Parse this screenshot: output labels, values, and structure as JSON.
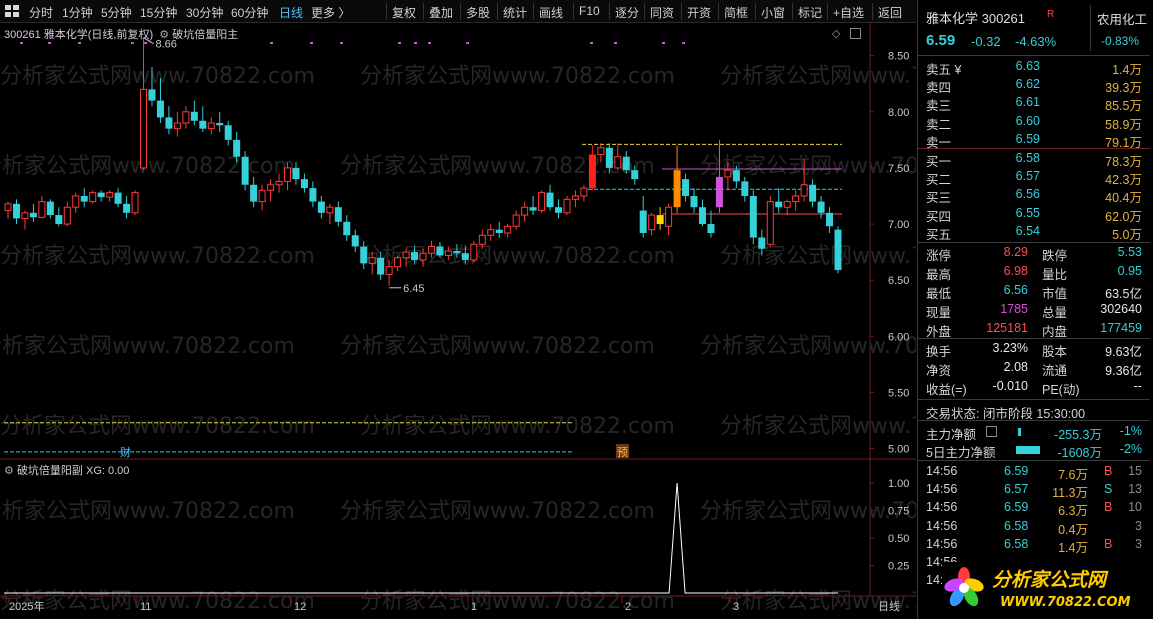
{
  "toolbar": {
    "left_items": [
      "分时",
      "1分钟",
      "5分钟",
      "15分钟",
      "30分钟",
      "60分钟",
      "日线",
      "更多 〉"
    ],
    "active": "日线",
    "right_items": [
      "复权",
      "叠加",
      "多股",
      "统计",
      "画线",
      "F10",
      "逐分",
      "同资",
      "开资",
      "简框",
      "小窗",
      "标记",
      "+自选",
      "返回"
    ]
  },
  "main_chart": {
    "title": "300261 雅本化学(日线,前复权)",
    "indicator": "破坑倍量阳主",
    "high_label": "8.66",
    "low_label": "6.45",
    "marker_cai": "财",
    "marker_yu": "预",
    "watermark": "分析家公式网www.70822.com"
  },
  "sub_chart": {
    "title": "破坑倍量阳副",
    "xg_label": "XG: 0.00"
  },
  "chart_data": [
    {
      "type": "candlestick",
      "y_ticks": [
        "8.50",
        "8.00",
        "7.50",
        "7.00",
        "6.50",
        "6.00",
        "5.50",
        "5.00"
      ],
      "ylim": [
        4.96,
        8.72
      ],
      "x_ticks": [
        "2025年",
        "11",
        "12",
        "1",
        "2",
        "3"
      ],
      "x_tick_label_right": "日线",
      "marked_high": 8.66,
      "marked_low": 6.45,
      "horizontal_lines": [
        {
          "color": "#e6d54a",
          "value": 5.23
        },
        {
          "color": "#35d0d8",
          "value": 4.97
        },
        {
          "color": "#e6d54a",
          "value": 7.71
        },
        {
          "color": "#d152d8",
          "value": 7.49
        },
        {
          "color": "#35d0d8",
          "value": 7.31
        },
        {
          "color": "#ff4d4d",
          "value": 7.09
        }
      ],
      "candles": [
        [
          7.12,
          7.2,
          7.05,
          7.18
        ],
        [
          7.18,
          7.22,
          7.0,
          7.05
        ],
        [
          7.05,
          7.12,
          6.95,
          7.1
        ],
        [
          7.1,
          7.18,
          7.02,
          7.06
        ],
        [
          7.06,
          7.25,
          7.05,
          7.2
        ],
        [
          7.2,
          7.22,
          7.05,
          7.08
        ],
        [
          7.08,
          7.15,
          6.98,
          7.0
        ],
        [
          7.0,
          7.2,
          6.98,
          7.15
        ],
        [
          7.15,
          7.28,
          7.1,
          7.25
        ],
        [
          7.25,
          7.32,
          7.15,
          7.2
        ],
        [
          7.2,
          7.3,
          7.18,
          7.28
        ],
        [
          7.28,
          7.3,
          7.2,
          7.24
        ],
        [
          7.24,
          7.3,
          7.2,
          7.28
        ],
        [
          7.28,
          7.32,
          7.15,
          7.18
        ],
        [
          7.18,
          7.25,
          7.05,
          7.1
        ],
        [
          7.1,
          7.3,
          7.08,
          7.28
        ],
        [
          7.5,
          8.66,
          7.48,
          8.2
        ],
        [
          8.2,
          8.4,
          8.05,
          8.1
        ],
        [
          8.1,
          8.3,
          7.9,
          7.95
        ],
        [
          7.95,
          8.05,
          7.8,
          7.85
        ],
        [
          7.85,
          8.0,
          7.78,
          7.9
        ],
        [
          7.9,
          8.05,
          7.85,
          8.0
        ],
        [
          8.0,
          8.1,
          7.88,
          7.92
        ],
        [
          7.92,
          8.05,
          7.82,
          7.85
        ],
        [
          7.85,
          7.95,
          7.8,
          7.9
        ],
        [
          7.9,
          8.0,
          7.82,
          7.88
        ],
        [
          7.88,
          7.92,
          7.7,
          7.75
        ],
        [
          7.75,
          7.82,
          7.55,
          7.6
        ],
        [
          7.6,
          7.65,
          7.3,
          7.35
        ],
        [
          7.35,
          7.42,
          7.15,
          7.2
        ],
        [
          7.2,
          7.35,
          7.12,
          7.3
        ],
        [
          7.3,
          7.4,
          7.2,
          7.35
        ],
        [
          7.35,
          7.45,
          7.28,
          7.38
        ],
        [
          7.38,
          7.55,
          7.3,
          7.5
        ],
        [
          7.5,
          7.55,
          7.35,
          7.4
        ],
        [
          7.4,
          7.45,
          7.28,
          7.32
        ],
        [
          7.32,
          7.38,
          7.15,
          7.2
        ],
        [
          7.2,
          7.25,
          7.05,
          7.1
        ],
        [
          7.1,
          7.18,
          7.0,
          7.15
        ],
        [
          7.15,
          7.2,
          6.98,
          7.02
        ],
        [
          7.02,
          7.08,
          6.85,
          6.9
        ],
        [
          6.9,
          6.95,
          6.75,
          6.8
        ],
        [
          6.8,
          6.85,
          6.6,
          6.65
        ],
        [
          6.65,
          6.75,
          6.55,
          6.7
        ],
        [
          6.7,
          6.75,
          6.5,
          6.55
        ],
        [
          6.55,
          6.68,
          6.45,
          6.62
        ],
        [
          6.62,
          6.72,
          6.58,
          6.7
        ],
        [
          6.7,
          6.78,
          6.62,
          6.75
        ],
        [
          6.75,
          6.8,
          6.65,
          6.68
        ],
        [
          6.68,
          6.78,
          6.62,
          6.74
        ],
        [
          6.74,
          6.85,
          6.7,
          6.8
        ],
        [
          6.8,
          6.84,
          6.7,
          6.72
        ],
        [
          6.72,
          6.8,
          6.68,
          6.76
        ],
        [
          6.76,
          6.82,
          6.7,
          6.74
        ],
        [
          6.74,
          6.8,
          6.65,
          6.68
        ],
        [
          6.68,
          6.85,
          6.66,
          6.82
        ],
        [
          6.82,
          6.95,
          6.78,
          6.9
        ],
        [
          6.9,
          7.0,
          6.85,
          6.95
        ],
        [
          6.95,
          7.02,
          6.88,
          6.92
        ],
        [
          6.92,
          7.0,
          6.88,
          6.98
        ],
        [
          6.98,
          7.12,
          6.95,
          7.08
        ],
        [
          7.08,
          7.2,
          7.02,
          7.15
        ],
        [
          7.15,
          7.25,
          7.08,
          7.12
        ],
        [
          7.12,
          7.3,
          7.1,
          7.28
        ],
        [
          7.28,
          7.35,
          7.12,
          7.15
        ],
        [
          7.15,
          7.22,
          7.05,
          7.1
        ],
        [
          7.1,
          7.25,
          7.08,
          7.22
        ],
        [
          7.22,
          7.3,
          7.15,
          7.25
        ],
        [
          7.25,
          7.35,
          7.2,
          7.32
        ],
        [
          7.32,
          7.7,
          7.3,
          7.62
        ],
        [
          7.62,
          7.72,
          7.55,
          7.68
        ],
        [
          7.68,
          7.72,
          7.45,
          7.5
        ],
        [
          7.5,
          7.72,
          7.48,
          7.6
        ],
        [
          7.6,
          7.65,
          7.45,
          7.48
        ],
        [
          7.48,
          7.52,
          7.35,
          7.4
        ],
        [
          7.12,
          7.25,
          6.88,
          6.92
        ],
        [
          6.95,
          7.1,
          6.9,
          7.08
        ],
        [
          7.08,
          7.15,
          6.95,
          7.0
        ],
        [
          6.98,
          7.18,
          6.9,
          7.15
        ],
        [
          7.15,
          7.7,
          7.1,
          7.48
        ],
        [
          7.4,
          7.45,
          7.2,
          7.25
        ],
        [
          7.25,
          7.32,
          7.1,
          7.15
        ],
        [
          7.15,
          7.22,
          6.98,
          7.0
        ],
        [
          7.0,
          7.12,
          6.88,
          6.92
        ],
        [
          7.15,
          7.75,
          7.1,
          7.42
        ],
        [
          7.42,
          7.55,
          7.3,
          7.48
        ],
        [
          7.48,
          7.52,
          7.32,
          7.38
        ],
        [
          7.38,
          7.42,
          7.2,
          7.25
        ],
        [
          7.25,
          7.3,
          6.82,
          6.88
        ],
        [
          6.88,
          6.95,
          6.72,
          6.78
        ],
        [
          6.82,
          7.25,
          6.8,
          7.2
        ],
        [
          7.2,
          7.32,
          7.1,
          7.15
        ],
        [
          7.15,
          7.22,
          7.08,
          7.2
        ],
        [
          7.2,
          7.3,
          7.12,
          7.25
        ],
        [
          7.25,
          7.58,
          7.2,
          7.35
        ],
        [
          7.35,
          7.4,
          7.15,
          7.2
        ],
        [
          7.2,
          7.25,
          7.05,
          7.1
        ],
        [
          7.1,
          7.15,
          6.92,
          6.98
        ],
        [
          6.95,
          6.98,
          6.56,
          6.59
        ]
      ],
      "highlights": [
        {
          "index": 69,
          "color": "#ff2020"
        },
        {
          "index": 75,
          "color": "#35d0d8"
        },
        {
          "index": 77,
          "color": "#ffd700"
        },
        {
          "index": 79,
          "color": "#ff8c00"
        },
        {
          "index": 84,
          "color": "#d152d8"
        }
      ]
    },
    {
      "type": "line",
      "name": "XG",
      "y_ticks": [
        "1.00",
        "0.75",
        "0.50",
        "0.25",
        "0.00"
      ],
      "ylim": [
        0,
        1
      ],
      "spike_index": 79,
      "spike_value": 1.0
    }
  ],
  "quote": {
    "name_code": "雅本化学 300261",
    "r_badge": "R",
    "sector_name": "农用化工",
    "sector_change": "-0.83%",
    "price": "6.59",
    "change": "-0.32",
    "change_pct": "-4.63%",
    "asks": [
      {
        "label": "卖五 ¥",
        "price": "6.63",
        "vol": "1.4万"
      },
      {
        "label": "卖四",
        "price": "6.62",
        "vol": "39.3万"
      },
      {
        "label": "卖三",
        "price": "6.61",
        "vol": "85.5万"
      },
      {
        "label": "卖二",
        "price": "6.60",
        "vol": "58.9万"
      },
      {
        "label": "卖一",
        "price": "6.59",
        "vol": "79.1万"
      }
    ],
    "bids": [
      {
        "label": "买一",
        "price": "6.58",
        "vol": "78.3万"
      },
      {
        "label": "买二",
        "price": "6.57",
        "vol": "42.3万"
      },
      {
        "label": "买三",
        "price": "6.56",
        "vol": "40.4万"
      },
      {
        "label": "买四",
        "price": "6.55",
        "vol": "62.0万"
      },
      {
        "label": "买五",
        "price": "6.54",
        "vol": "5.0万"
      }
    ],
    "stats1": [
      {
        "k1": "涨停",
        "v1": "8.29",
        "k2": "跌停",
        "v2": "5.53"
      },
      {
        "k1": "最高",
        "v1": "6.98",
        "k2": "量比",
        "v2": "0.95"
      },
      {
        "k1": "最低",
        "v1": "6.56",
        "k2": "市值",
        "v2": "63.5亿"
      },
      {
        "k1": "现量",
        "v1": "1785",
        "k2": "总量",
        "v2": "302640"
      },
      {
        "k1": "外盘",
        "v1": "125181",
        "k2": "内盘",
        "v2": "177459"
      }
    ],
    "stats2": [
      {
        "k1": "换手",
        "v1": "3.23%",
        "k2": "股本",
        "v2": "9.63亿"
      },
      {
        "k1": "净资",
        "v1": "2.08",
        "k2": "流通",
        "v2": "9.36亿"
      },
      {
        "k1": "收益(=)",
        "v1": "-0.010",
        "k2": "PE(动)",
        "v2": "--"
      }
    ],
    "status_line": "交易状态: 闭市阶段 15:30:00",
    "flows": [
      {
        "label": "主力净额",
        "value": "-255.3万",
        "pct": "-1%"
      },
      {
        "label": "5日主力净额",
        "value": "-1608万",
        "pct": "-2%"
      }
    ],
    "ticks": [
      {
        "time": "14:56",
        "price": "6.59",
        "vol": "7.6万",
        "dir": "B",
        "n": "15"
      },
      {
        "time": "14:56",
        "price": "6.57",
        "vol": "11.3万",
        "dir": "S",
        "n": "13"
      },
      {
        "time": "14:56",
        "price": "6.59",
        "vol": "6.3万",
        "dir": "B",
        "n": "10"
      },
      {
        "time": "14:56",
        "price": "6.58",
        "vol": "0.4万",
        "dir": "",
        "n": "3"
      },
      {
        "time": "14:56",
        "price": "6.58",
        "vol": "1.4万",
        "dir": "B",
        "n": "3"
      },
      {
        "time": "14:56",
        "price": "",
        "vol": "",
        "dir": "",
        "n": ""
      },
      {
        "time": "14:56",
        "price": "",
        "vol": "",
        "dir": "",
        "n": ""
      }
    ]
  },
  "logo": {
    "cn": "分析家公式网",
    "url": "WWW.70822.COM"
  }
}
